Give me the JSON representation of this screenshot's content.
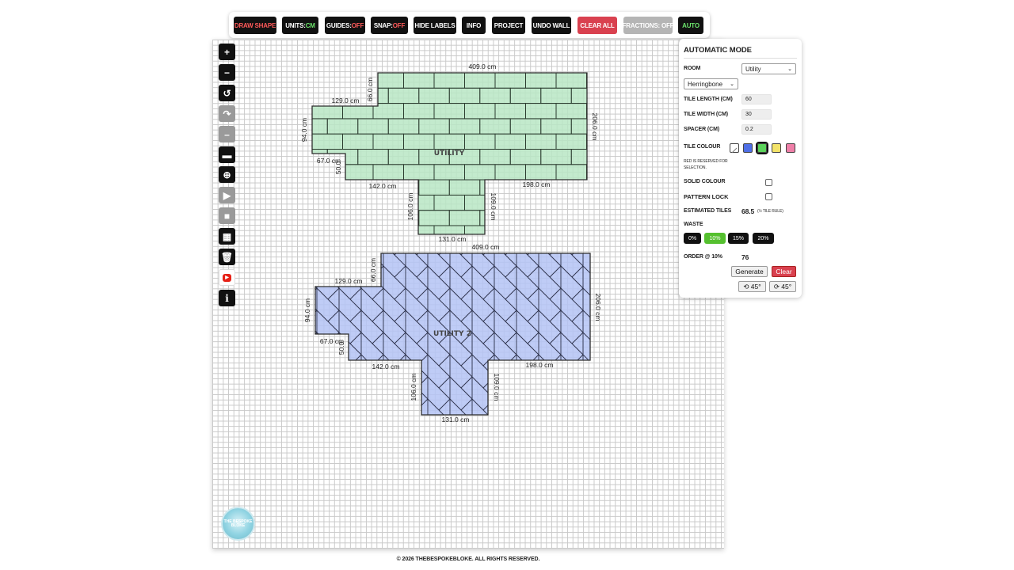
{
  "toolbar": {
    "draw_shape": "DRAW SHAPE",
    "units_label": "UNITS: ",
    "units_value": "CM",
    "guides_label": "GUIDES: ",
    "guides_value": "OFF",
    "snap_label": "SNAP: ",
    "snap_value": "OFF",
    "hide_labels": "HIDE LABELS",
    "info": "INFO",
    "project": "PROJECT",
    "undo_wall": "UNDO WALL",
    "clear_all": "CLEAR ALL",
    "fractions": "FRACTIONS: OFF",
    "auto": "AUTO"
  },
  "left_tools": [
    {
      "name": "zoom-in-icon",
      "glyph": "+"
    },
    {
      "name": "zoom-out-icon",
      "glyph": "−"
    },
    {
      "name": "rotate-icon",
      "glyph": "↺"
    },
    {
      "name": "redo-icon",
      "glyph": "↷"
    },
    {
      "name": "minus-icon",
      "glyph": "–"
    },
    {
      "name": "ruler-icon",
      "glyph": "▬"
    },
    {
      "name": "crosshair-icon",
      "glyph": "⊕"
    },
    {
      "name": "play-icon",
      "glyph": "▶"
    },
    {
      "name": "square-icon",
      "glyph": "■"
    },
    {
      "name": "grid-pattern-icon",
      "glyph": "▦"
    },
    {
      "name": "trash-icon",
      "glyph": "🗑"
    },
    {
      "name": "youtube-icon",
      "glyph": "▶"
    },
    {
      "name": "info-icon",
      "glyph": "i"
    }
  ],
  "rooms": [
    {
      "name": "UTILITY",
      "fill": "#b9e6c4",
      "stroke": "#2c2c2c",
      "pattern": "brick",
      "dims": {
        "top": "409.0 cm",
        "top_left": "129.0 cm",
        "top_step": "66.0 cm",
        "right": "206.0 cm",
        "left": "94.0 cm",
        "bottom_left_step": "67.0 cm",
        "small_step": "50.0",
        "bottom_left": "142.0 cm",
        "bottom_right": "198.0 cm",
        "leg_left": "106.0 cm",
        "leg_right": "109.0 cm",
        "bottom": "131.0 cm"
      }
    },
    {
      "name": "UTILITY 2",
      "fill": "#b4c3f5",
      "stroke": "#2c2c2c",
      "pattern": "herringbone",
      "dims": {
        "top": "409.0 cm",
        "top_left": "129.0 cm",
        "top_step": "66.0 cm",
        "right": "206.0 cm",
        "left": "94.0 cm",
        "bottom_left_step": "67.0 cm",
        "small_step": "50.0",
        "bottom_left": "142.0 cm",
        "bottom_right": "198.0 cm",
        "leg_left": "106.0 cm",
        "leg_right": "109.0 cm",
        "bottom": "131.0 cm"
      }
    }
  ],
  "panel": {
    "title": "AUTOMATIC MODE",
    "room_label": "ROOM",
    "room_value": "Utility",
    "pattern_value": "Herringbone",
    "tile_length_label": "TILE LENGTH (CM)",
    "tile_length_value": "60",
    "tile_width_label": "TILE WIDTH (CM)",
    "tile_width_value": "30",
    "spacer_label": "SPACER (CM)",
    "spacer_value": "0.2",
    "tile_colour_label": "TILE COLOUR",
    "swatches": [
      "#ffffff",
      "#4f6fe6",
      "#5bd35b",
      "#f3e36a",
      "#ef7fa8"
    ],
    "selected_swatch": 2,
    "red_note": "RED IS RESERVED FOR SELECTION.",
    "solid_colour_label": "SOLID COLOUR",
    "pattern_lock_label": "PATTERN LOCK",
    "estimated_label": "ESTIMATED TILES",
    "estimated_value": "68.5",
    "estimated_note": "(½ TILE RULE)",
    "waste_label": "WASTE",
    "waste_options": [
      "0%",
      "10%",
      "15%",
      "20%"
    ],
    "waste_selected": 1,
    "order_label": "ORDER @ 10%",
    "order_value": "76",
    "generate": "Generate",
    "clear": "Clear",
    "rot_left": "⟲ 45°",
    "rot_right": "⟳ 45°"
  },
  "logo_text": "THE BESPOKE BLOKE",
  "footer": "© 2026 THEBESPOKEBLOKE. ALL RIGHTS RESERVED."
}
